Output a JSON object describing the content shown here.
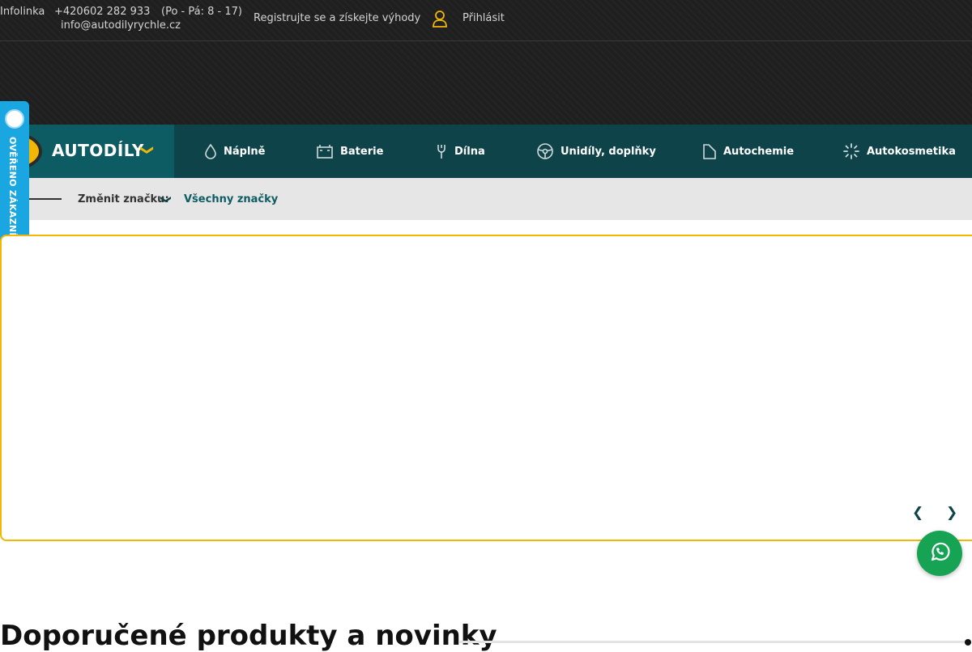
{
  "topbar": {
    "infolinka": "Infolinka",
    "phone": "+420602 282 933",
    "hours": "(Po - Pá: 8 - 17)",
    "email": "info@autodilyrychle.cz",
    "register": "Registrujte se a získejte výhody",
    "login": "Přihlásit",
    "user_icon": "user-icon"
  },
  "nav": {
    "brand_label": "AUTODÍLY",
    "brand_chevron": "❯",
    "items": [
      {
        "label": "Náplně",
        "icon": "drop-icon"
      },
      {
        "label": "Baterie",
        "icon": "battery-icon"
      },
      {
        "label": "Dílna",
        "icon": "wrench-icon"
      },
      {
        "label": "Unidíly, doplňky",
        "icon": "steering-wheel-icon"
      },
      {
        "label": "Autochemie",
        "icon": "bottle-icon"
      },
      {
        "label": "Autokosmetika",
        "icon": "sparkle-icon"
      }
    ]
  },
  "subbar": {
    "change_label": "Změnit značku:",
    "chevron": "❯",
    "all_brands": "Všechny značky"
  },
  "badge": {
    "text": "OVĚŘENO ZÁKAZNÍKY"
  },
  "banner": {
    "prev": "❮",
    "next": "❯"
  },
  "section": {
    "title": "Doporučené produkty a novinky"
  },
  "colors": {
    "topbar_bg": "#1f1f1f",
    "nav_bg": "#0d4349",
    "brand_bg": "#0e5c63",
    "accent": "#f2b705",
    "badge": "#1aa6e0",
    "whatsapp": "#17a354"
  }
}
